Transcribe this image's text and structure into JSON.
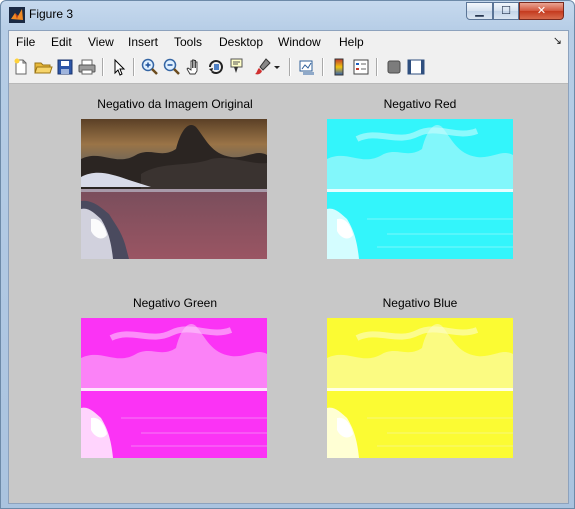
{
  "window": {
    "title": "Figure 3",
    "buttons": {
      "minimize": "▁",
      "maximize": "☐",
      "close": "✕"
    }
  },
  "menubar": {
    "items": [
      "File",
      "Edit",
      "View",
      "Insert",
      "Tools",
      "Desktop",
      "Window",
      "Help"
    ],
    "overflow_icon": "dock-arrow-icon"
  },
  "toolbar": {
    "icons": [
      "new-figure-icon",
      "open-file-icon",
      "save-icon",
      "print-icon",
      "edit-plot-arrow-icon",
      "zoom-in-icon",
      "zoom-out-icon",
      "pan-hand-icon",
      "rotate-3d-icon",
      "data-cursor-icon",
      "brush-icon",
      "brush-dropdown-icon",
      "link-plot-icon",
      "colorbar-icon",
      "legend-icon",
      "hide-plot-tools-icon",
      "show-plot-tools-icon"
    ]
  },
  "plots": [
    {
      "title": "Negativo da Imagem Original",
      "scheme": "original-negative"
    },
    {
      "title": "Negativo Red",
      "scheme": "cyan"
    },
    {
      "title": "Negativo Green",
      "scheme": "magenta"
    },
    {
      "title": "Negativo Blue",
      "scheme": "yellow"
    }
  ],
  "colors": {
    "client_background": "#c8c8c8",
    "cyan": "#33f5fb",
    "magenta": "#fb33f5",
    "yellow": "#fbfb33"
  }
}
